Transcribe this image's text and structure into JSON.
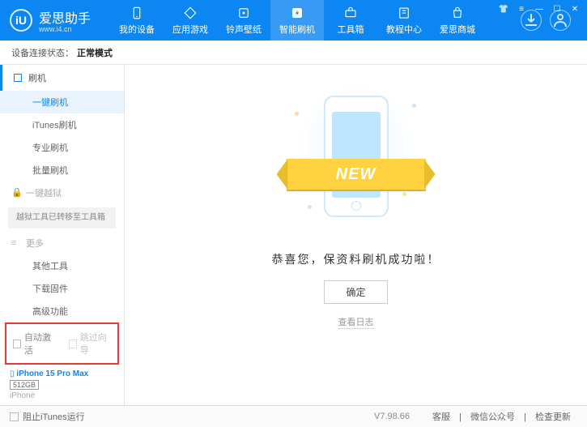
{
  "app": {
    "name": "爱思助手",
    "url": "www.i4.cn",
    "logo_letter": "iU"
  },
  "nav": [
    {
      "label": "我的设备",
      "icon": "device"
    },
    {
      "label": "应用游戏",
      "icon": "apps"
    },
    {
      "label": "铃声壁纸",
      "icon": "ringtone"
    },
    {
      "label": "智能刷机",
      "icon": "flash",
      "active": true
    },
    {
      "label": "工具箱",
      "icon": "toolbox"
    },
    {
      "label": "教程中心",
      "icon": "tutorial"
    },
    {
      "label": "爱思商城",
      "icon": "store"
    }
  ],
  "status": {
    "prefix": "设备连接状态：",
    "value": "正常模式"
  },
  "sidebar": {
    "flash_header": "刷机",
    "items": [
      {
        "label": "一键刷机",
        "active": true
      },
      {
        "label": "iTunes刷机"
      },
      {
        "label": "专业刷机"
      },
      {
        "label": "批量刷机"
      }
    ],
    "jailbreak_header": "一键越狱",
    "jailbreak_note": "越狱工具已转移至工具箱",
    "more_header": "更多",
    "more_items": [
      {
        "label": "其他工具"
      },
      {
        "label": "下载固件"
      },
      {
        "label": "高级功能"
      }
    ],
    "checkbox1": "自动激活",
    "checkbox2": "跳过向导"
  },
  "device": {
    "name": "iPhone 15 Pro Max",
    "storage": "512GB",
    "type": "iPhone"
  },
  "main": {
    "ribbon": "NEW",
    "message": "恭喜您，保资料刷机成功啦！",
    "ok": "确定",
    "log": "查看日志"
  },
  "footer": {
    "block_itunes": "阻止iTunes运行",
    "version": "V7.98.66",
    "links": [
      "客服",
      "微信公众号",
      "检查更新"
    ]
  }
}
